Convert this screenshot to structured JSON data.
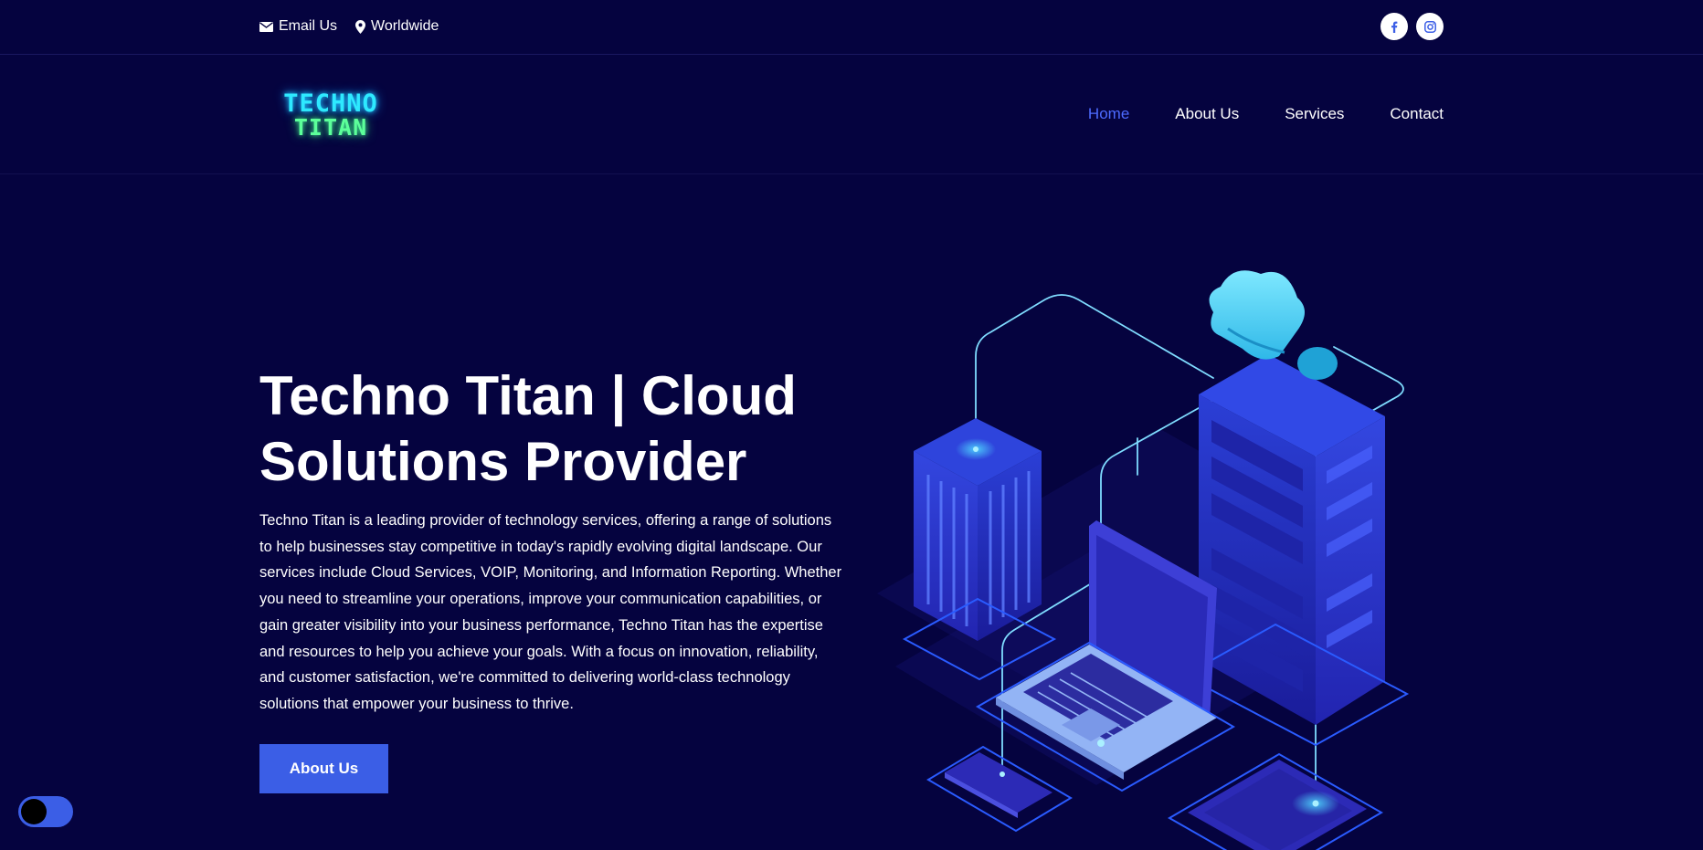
{
  "topbar": {
    "email": {
      "label": "Email Us",
      "icon": "envelope-icon"
    },
    "location": {
      "label": "Worldwide",
      "icon": "map-pin-icon"
    },
    "social": [
      {
        "name": "facebook",
        "icon": "facebook-icon"
      },
      {
        "name": "instagram",
        "icon": "instagram-icon"
      }
    ]
  },
  "header": {
    "logo": {
      "line1": "TECHNO",
      "line2": "TITAN"
    },
    "nav": [
      {
        "label": "Home",
        "active": true
      },
      {
        "label": "About Us",
        "active": false
      },
      {
        "label": "Services",
        "active": false
      },
      {
        "label": "Contact",
        "active": false
      }
    ]
  },
  "hero": {
    "title_line1": "Techno Titan | Cloud",
    "title_line2": "Solutions Provider",
    "description": "Techno Titan is a leading provider of technology services, offering a range of solutions to help businesses stay competitive in today's rapidly evolving digital landscape. Our services include Cloud Services, VOIP, Monitoring, and Information Reporting. Whether you need to streamline your operations, improve your communication capabilities, or gain greater visibility into your business performance, Techno Titan has the expertise and resources to help you achieve your goals. With a focus on innovation, reliability, and customer satisfaction, we're committed to delivering world-class technology solutions that empower your business to thrive.",
    "button_label": "About Us"
  },
  "theme_toggle": {
    "state": "dark"
  },
  "colors": {
    "background": "#05033f",
    "accent": "#3b5ee6",
    "nav_active": "#4d6bff",
    "logo_cyan": "#2ee9ff",
    "logo_green": "#5cff9a"
  }
}
